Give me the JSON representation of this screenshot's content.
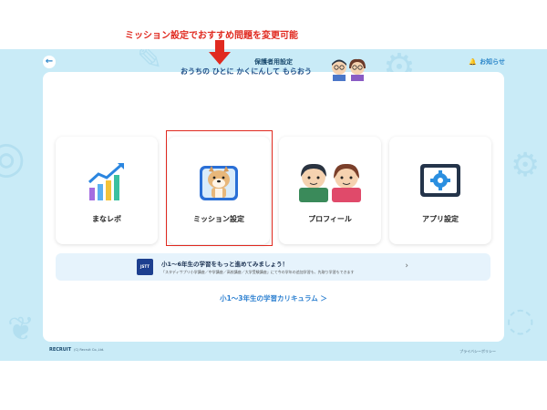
{
  "header": {
    "back_icon": "arrow-left-icon",
    "title": "保護者用設定",
    "notice_label": "お知らせ",
    "notice_icon": "bell-icon"
  },
  "annotation": {
    "text": "ミッション設定でおすすめ問題を変更可能",
    "color": "#e02a20"
  },
  "prompt": "おうちの ひとに かくにんして もらおう",
  "cards": [
    {
      "label": "まなレポ",
      "icon": "bar-chart-icon"
    },
    {
      "label": "ミッション設定",
      "icon": "dog-mascot-icon"
    },
    {
      "label": "プロフィール",
      "icon": "children-icon"
    },
    {
      "label": "アプリ設定",
      "icon": "gear-icon"
    }
  ],
  "banner": {
    "logo_text": "JSTT",
    "title": "小1～6年生の学習をもっと進めてみましょう！",
    "subtitle": "「スタディサプリ小学講座／中学講座／高校講座／大学受験講座」にて今の学年の追加学習も、先取り学習もできます"
  },
  "curriculum_link": "小1～3年生の学習カリキュラム ＞",
  "footer": {
    "brand": "RECRUIT",
    "brand_sub": "(C) Recruit Co.,Ltd.",
    "privacy": "プライバシーポリシー"
  },
  "colors": {
    "background": "#c9ebf7",
    "accent": "#2b86c9",
    "highlight": "#e02a20"
  }
}
